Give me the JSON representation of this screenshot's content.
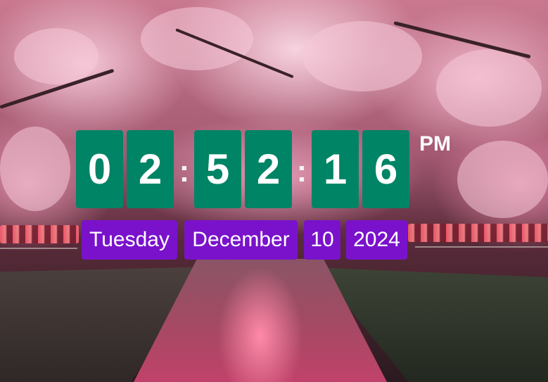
{
  "clock": {
    "hour_tens": "0",
    "hour_ones": "2",
    "minute_tens": "5",
    "minute_ones": "2",
    "second_tens": "1",
    "second_ones": "6",
    "separator": ":",
    "period": "PM"
  },
  "date": {
    "weekday": "Tuesday",
    "month": "December",
    "day": "10",
    "year": "2024"
  },
  "colors": {
    "digit_background": "#008466",
    "date_background": "#7a12cc",
    "text": "#ffffff"
  }
}
